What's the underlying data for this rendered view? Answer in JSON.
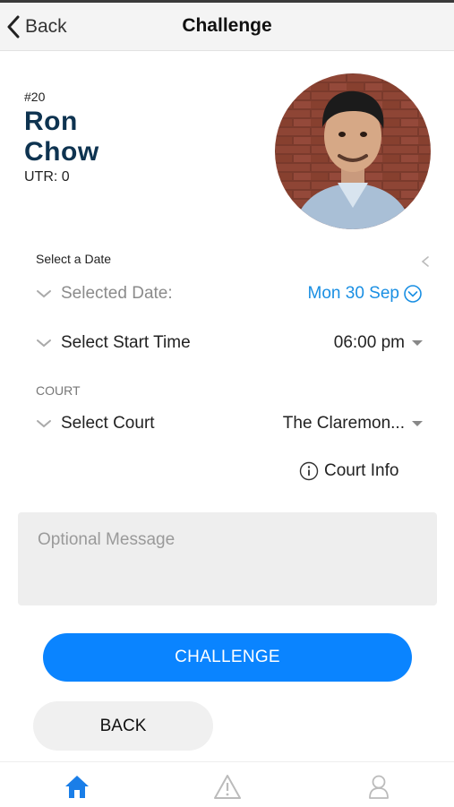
{
  "nav": {
    "back_label": "Back",
    "title": "Challenge"
  },
  "profile": {
    "rank": "#20",
    "first_name": "Ron",
    "last_name": "Chow",
    "utr": "UTR: 0"
  },
  "date_section": {
    "caption": "Select a Date",
    "selected_label": "Selected Date:",
    "selected_value": "Mon 30 Sep"
  },
  "time_section": {
    "label": "Select Start Time",
    "value": "06:00 pm"
  },
  "court_section": {
    "caption": "COURT",
    "label": "Select Court",
    "value": "The Claremon...",
    "info_label": "Court Info"
  },
  "message": {
    "placeholder": "Optional Message",
    "value": ""
  },
  "actions": {
    "challenge_label": "CHALLENGE",
    "back_label": "BACK"
  },
  "tabs": [
    {
      "icon": "home-icon",
      "active": true
    },
    {
      "icon": "warning-icon",
      "active": false
    },
    {
      "icon": "user-icon",
      "active": false
    }
  ],
  "colors": {
    "accent": "#0a84ff",
    "date_value": "#1a8fe3",
    "name": "#0e3350"
  }
}
